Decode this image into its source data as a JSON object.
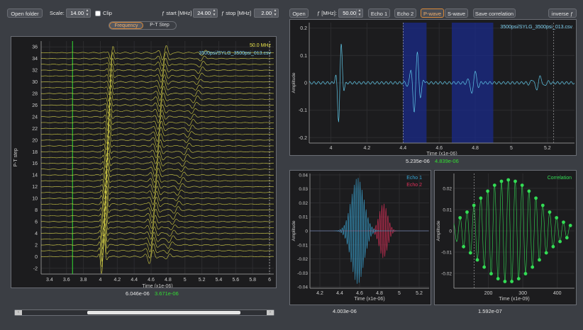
{
  "toolbar_left": {
    "open_folder": "Open folder",
    "scale_label": "Scale:",
    "scale_value": "14.00",
    "clip_label": "Clip",
    "fstart_label": "ƒ start [MHz]",
    "fstart_value": "24.00",
    "fstop_label": "ƒ stop [MHz]",
    "fstop_value": "2.00"
  },
  "toolbar_right": {
    "open": "Open",
    "freq_label": "ƒ [MHz]:",
    "freq_value": "50.00",
    "echo1": "Echo 1",
    "echo2": "Echo 2",
    "pwave": "P-wave",
    "swave": "S-wave",
    "save_corr": "Save correlation",
    "inverse": "inverse ƒ"
  },
  "mode_toggle": {
    "frequency": "Frequency",
    "pt_step": "P-T Step"
  },
  "left_plot": {
    "freq_text": "50.0 MHz",
    "file_text": "3500psi/SYLG_3500psi_013.csv",
    "ylabel": "P-T step",
    "xlabel": "Time (x1e-06)",
    "xticks": [
      "3.4",
      "3.6",
      "3.8",
      "4",
      "4.2",
      "4.4",
      "4.6",
      "4.8",
      "5",
      "5.2",
      "5.4",
      "5.6",
      "5.8",
      "6"
    ],
    "yticks": [
      "-2",
      "0",
      "2",
      "4",
      "6",
      "8",
      "10",
      "12",
      "14",
      "16",
      "18",
      "20",
      "22",
      "24",
      "26",
      "28",
      "30",
      "32",
      "34",
      "36"
    ],
    "readout_white": "6.046e-06",
    "readout_green": "3.671e-06"
  },
  "top_right_plot": {
    "file_text": "3500psi/SYLG_3500psi_013.csv",
    "ylabel": "Amplitude",
    "xlabel": "Time (x1e-06)",
    "xticks": [
      "4",
      "4.2",
      "4.4",
      "4.6",
      "4.8",
      "5",
      "5.2"
    ],
    "yticks": [
      "0.2",
      "0.1",
      "0",
      "-0.1",
      "-0.2"
    ],
    "readout_white": "5.235e-06",
    "readout_green": "4.839e-06"
  },
  "echo_plot": {
    "legend1": "Echo 1",
    "legend2": "Echo 2",
    "ylabel": "Amplitude",
    "xlabel": "Time (x1e-06)",
    "xticks": [
      "4.2",
      "4.4",
      "4.6",
      "4.8",
      "5",
      "5.2"
    ],
    "yticks": [
      "0.04",
      "0.03",
      "0.02",
      "0.01",
      "0",
      "-0.01",
      "-0.02",
      "-0.03",
      "-0.04"
    ],
    "readout": "4.003e-06"
  },
  "corr_plot": {
    "legend": "Correlation",
    "ylabel": "Amplitude",
    "xlabel": "Time (x1e-09)",
    "xticks": [
      "200",
      "300",
      "400"
    ],
    "yticks": [
      "0.02",
      "0.01",
      "0",
      "-0.01",
      "-0.02"
    ],
    "readout": "1.592e-07"
  },
  "colors": {
    "trace": "#e8e24a",
    "echo1": "#3aa8d8",
    "echo2": "#e0305a",
    "corr": "#33dd55",
    "green_text": "#33dd33"
  }
}
